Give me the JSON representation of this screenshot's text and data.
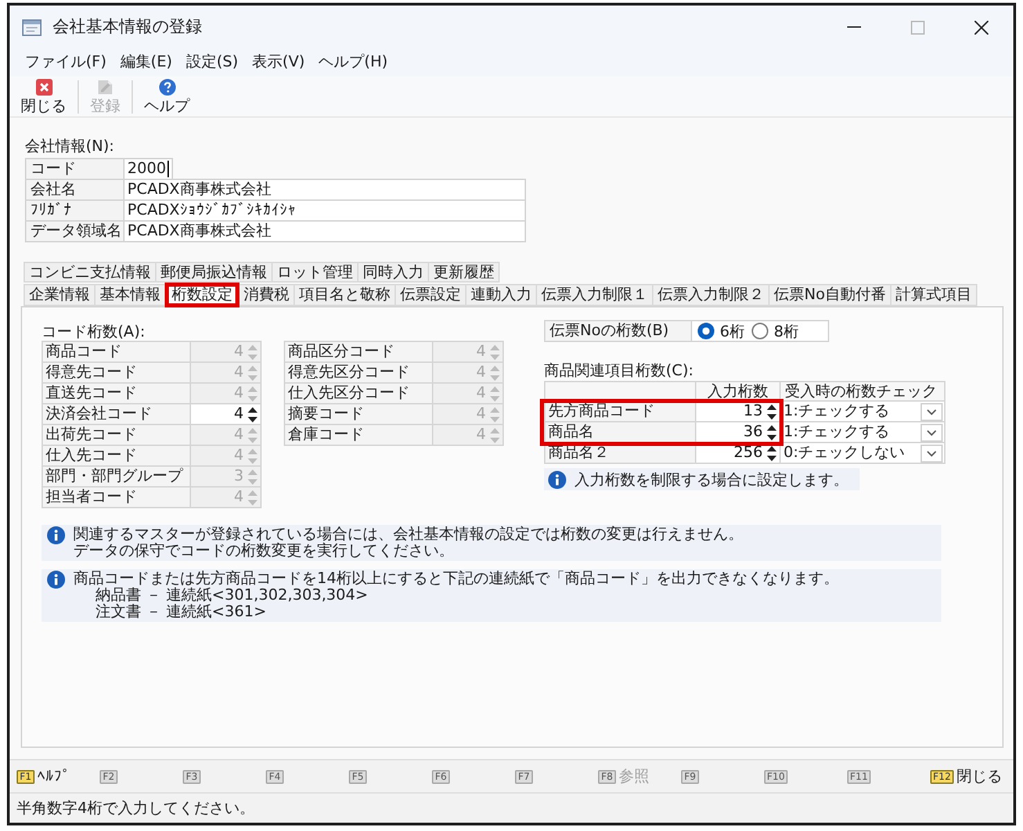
{
  "window": {
    "title": "会社基本情報の登録",
    "controls": [
      {
        "kind": "minimize",
        "disabled": false
      },
      {
        "kind": "maximize",
        "disabled": true
      },
      {
        "kind": "close",
        "disabled": false
      }
    ]
  },
  "menu": [
    "ファイル(F)",
    "編集(E)",
    "設定(S)",
    "表示(V)",
    "ヘルプ(H)"
  ],
  "toolbar": [
    {
      "kind": "close",
      "label": "閉じる",
      "disabled": false
    },
    {
      "kind": "register",
      "label": "登録",
      "disabled": true
    },
    {
      "kind": "help",
      "label": "ヘルプ",
      "disabled": false
    }
  ],
  "company": {
    "title": "会社情報(N):",
    "fields": [
      {
        "kind": "short",
        "label": "コード",
        "value": "2000",
        "focused": true
      },
      {
        "kind": "long",
        "label": "会社名",
        "value": "PCADX商事株式会社",
        "focused": false
      },
      {
        "kind": "long",
        "label": "ﾌﾘｶﾞﾅ",
        "value": "PCADXｼｮｳｼﾞｶﾌﾞｼｷｶｲｼｬ",
        "focused": false
      },
      {
        "kind": "long",
        "label": "データ領域名",
        "value": "PCADX商事株式会社",
        "focused": false
      }
    ]
  },
  "tab_rows": [
    {
      "tabs": [
        {
          "label": "コンビニ支払情報",
          "selected": false,
          "highlighted": false
        },
        {
          "label": "郵便局振込情報",
          "selected": false,
          "highlighted": false
        },
        {
          "label": "ロット管理",
          "selected": false,
          "highlighted": false
        },
        {
          "label": "同時入力",
          "selected": false,
          "highlighted": false
        },
        {
          "label": "更新履歴",
          "selected": false,
          "highlighted": false
        }
      ]
    },
    {
      "tabs": [
        {
          "label": "企業情報",
          "selected": false,
          "highlighted": false
        },
        {
          "label": "基本情報",
          "selected": false,
          "highlighted": false
        },
        {
          "label": "桁数設定",
          "selected": true,
          "highlighted": true
        },
        {
          "label": "消費税",
          "selected": false,
          "highlighted": false
        },
        {
          "label": "項目名と敬称",
          "selected": false,
          "highlighted": false
        },
        {
          "label": "伝票設定",
          "selected": false,
          "highlighted": false
        },
        {
          "label": "連動入力",
          "selected": false,
          "highlighted": false
        },
        {
          "label": "伝票入力制限１",
          "selected": false,
          "highlighted": false
        },
        {
          "label": "伝票入力制限２",
          "selected": false,
          "highlighted": false
        },
        {
          "label": "伝票No自動付番",
          "selected": false,
          "highlighted": false
        },
        {
          "label": "計算式項目",
          "selected": false,
          "highlighted": false
        }
      ]
    }
  ],
  "code_digits": {
    "title": "コード桁数(A):",
    "columns": [
      {
        "items": [
          {
            "label": "商品コード",
            "value": "4",
            "disabled": true
          },
          {
            "label": "得意先コード",
            "value": "4",
            "disabled": true
          },
          {
            "label": "直送先コード",
            "value": "4",
            "disabled": true
          },
          {
            "label": "決済会社コード",
            "value": "4",
            "disabled": false
          },
          {
            "label": "出荷先コード",
            "value": "4",
            "disabled": true
          },
          {
            "label": "仕入先コード",
            "value": "4",
            "disabled": true
          },
          {
            "label": "部門・部門グループ",
            "value": "3",
            "disabled": true
          },
          {
            "label": "担当者コード",
            "value": "4",
            "disabled": true
          }
        ]
      },
      {
        "items": [
          {
            "label": "商品区分コード",
            "value": "4",
            "disabled": true
          },
          {
            "label": "得意先区分コード",
            "value": "4",
            "disabled": true
          },
          {
            "label": "仕入先区分コード",
            "value": "4",
            "disabled": true
          },
          {
            "label": "摘要コード",
            "value": "4",
            "disabled": true
          },
          {
            "label": "倉庫コード",
            "value": "4",
            "disabled": true
          }
        ]
      }
    ]
  },
  "slip_no_digits": {
    "label": "伝票Noの桁数(B)",
    "options": [
      {
        "label": "6桁",
        "selected": true
      },
      {
        "label": "8桁",
        "selected": false
      }
    ]
  },
  "product_digits": {
    "title": "商品関連項目桁数(C):",
    "columns": [
      "入力桁数",
      "受入時の桁数チェック"
    ],
    "rows": [
      {
        "label": "先方商品コード",
        "digits": "13",
        "check": "1:チェックする",
        "highlighted": true
      },
      {
        "label": "商品名",
        "digits": "36",
        "check": "1:チェックする",
        "highlighted": true
      },
      {
        "label": "商品名２",
        "digits": "256",
        "check": "0:チェックしない",
        "highlighted": false
      }
    ],
    "hint": "入力桁数を制限する場合に設定します。"
  },
  "notes": [
    {
      "lines": [
        {
          "kind": "main",
          "text": "関連するマスターが登録されている場合には、会社基本情報の設定では桁数の変更は行えません。"
        },
        {
          "kind": "main",
          "text": "データの保守でコードの桁数変更を実行してください。"
        }
      ]
    },
    {
      "lines": [
        {
          "kind": "main",
          "text": "商品コードまたは先方商品コードを14桁以上にすると下記の連続紙で「商品コード」を出力できなくなります。"
        },
        {
          "kind": "sub",
          "text": "納品書 － 連続紙<301,302,303,304>"
        },
        {
          "kind": "sub",
          "text": "注文書 － 連続紙<361>"
        }
      ]
    }
  ],
  "function_keys": [
    {
      "key": "F1",
      "label": "ﾍﾙﾌﾟ",
      "disabled": false
    },
    {
      "key": "F2",
      "disabled": true
    },
    {
      "key": "F3",
      "disabled": true
    },
    {
      "key": "F4",
      "disabled": true
    },
    {
      "key": "F5",
      "disabled": true
    },
    {
      "key": "F6",
      "disabled": true
    },
    {
      "key": "F7",
      "disabled": true
    },
    {
      "key": "F8",
      "label": "参照",
      "disabled": true
    },
    {
      "key": "F9",
      "disabled": true
    },
    {
      "key": "F10",
      "disabled": true
    },
    {
      "key": "F11",
      "disabled": true
    },
    {
      "key": "F12",
      "label": "閉じる",
      "disabled": false
    }
  ],
  "status": "半角数字4桁で入力してください。"
}
